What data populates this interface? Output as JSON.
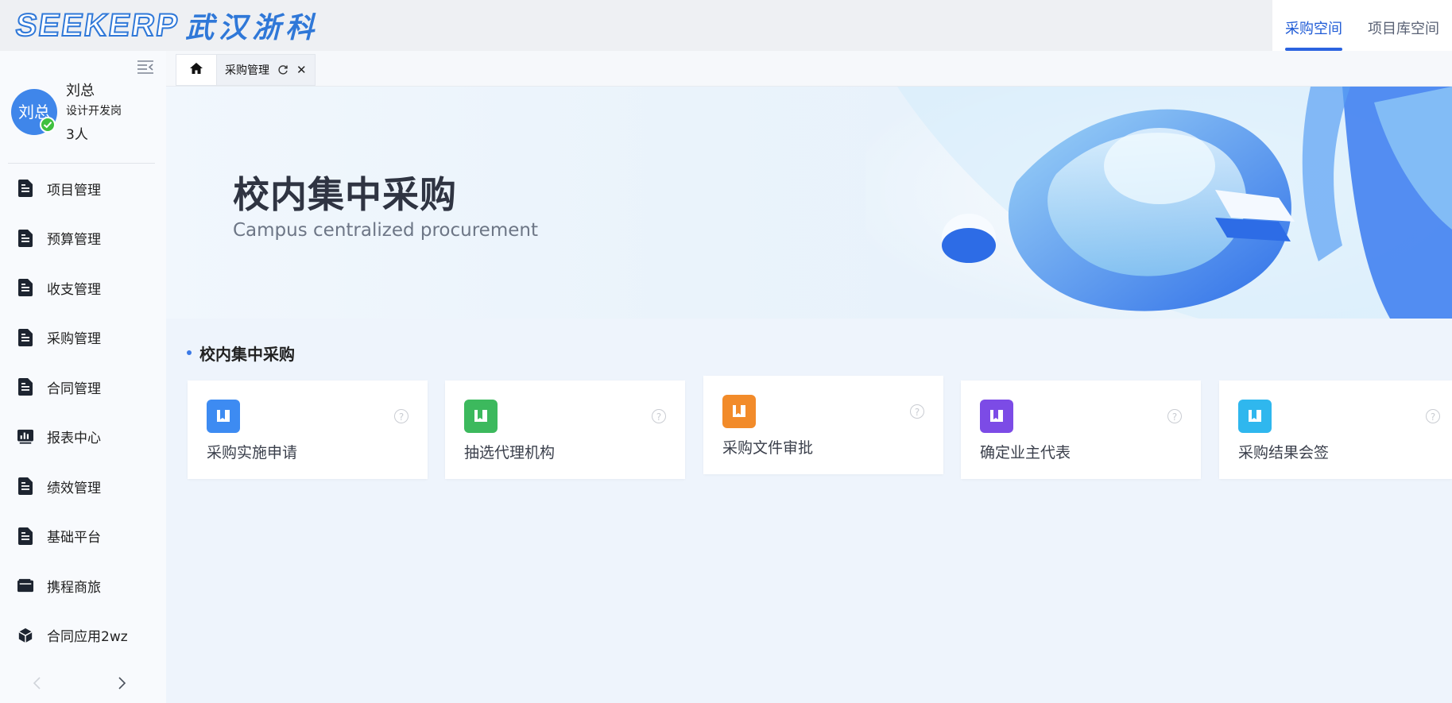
{
  "brand": {
    "logo_latin": "SEEKERP",
    "logo_cn": "武汉浙科",
    "primary_color": "#2f78d8"
  },
  "header_tabs": [
    {
      "label": "采购空间",
      "active": true
    },
    {
      "label": "项目库空间",
      "active": false
    }
  ],
  "user": {
    "avatar_text": "刘总",
    "name": "刘总",
    "role": "设计开发岗",
    "count": "3人"
  },
  "sidebar": {
    "items": [
      {
        "label": "项目管理",
        "icon": "document-icon"
      },
      {
        "label": "预算管理",
        "icon": "document-icon"
      },
      {
        "label": "收支管理",
        "icon": "document-icon"
      },
      {
        "label": "采购管理",
        "icon": "document-icon"
      },
      {
        "label": "合同管理",
        "icon": "document-icon"
      },
      {
        "label": "报表中心",
        "icon": "bar-chart-icon"
      },
      {
        "label": "绩效管理",
        "icon": "document-icon"
      },
      {
        "label": "基础平台",
        "icon": "document-icon"
      },
      {
        "label": "携程商旅",
        "icon": "wallet-icon"
      },
      {
        "label": "合同应用2wz",
        "icon": "cube-icon"
      }
    ]
  },
  "tabs": {
    "current_label": "采购管理"
  },
  "banner": {
    "title": "校内集中采购",
    "subtitle": "Campus centralized procurement"
  },
  "section": {
    "title": "校内集中采购",
    "cards": [
      {
        "label": "采购实施申请",
        "color": "#3d8bf2"
      },
      {
        "label": "抽选代理机构",
        "color": "#3cb95d"
      },
      {
        "label": "采购文件审批",
        "color": "#f28b2a"
      },
      {
        "label": "确定业主代表",
        "color": "#7c4be6"
      },
      {
        "label": "采购结果会签",
        "color": "#2fb7ee"
      }
    ]
  }
}
